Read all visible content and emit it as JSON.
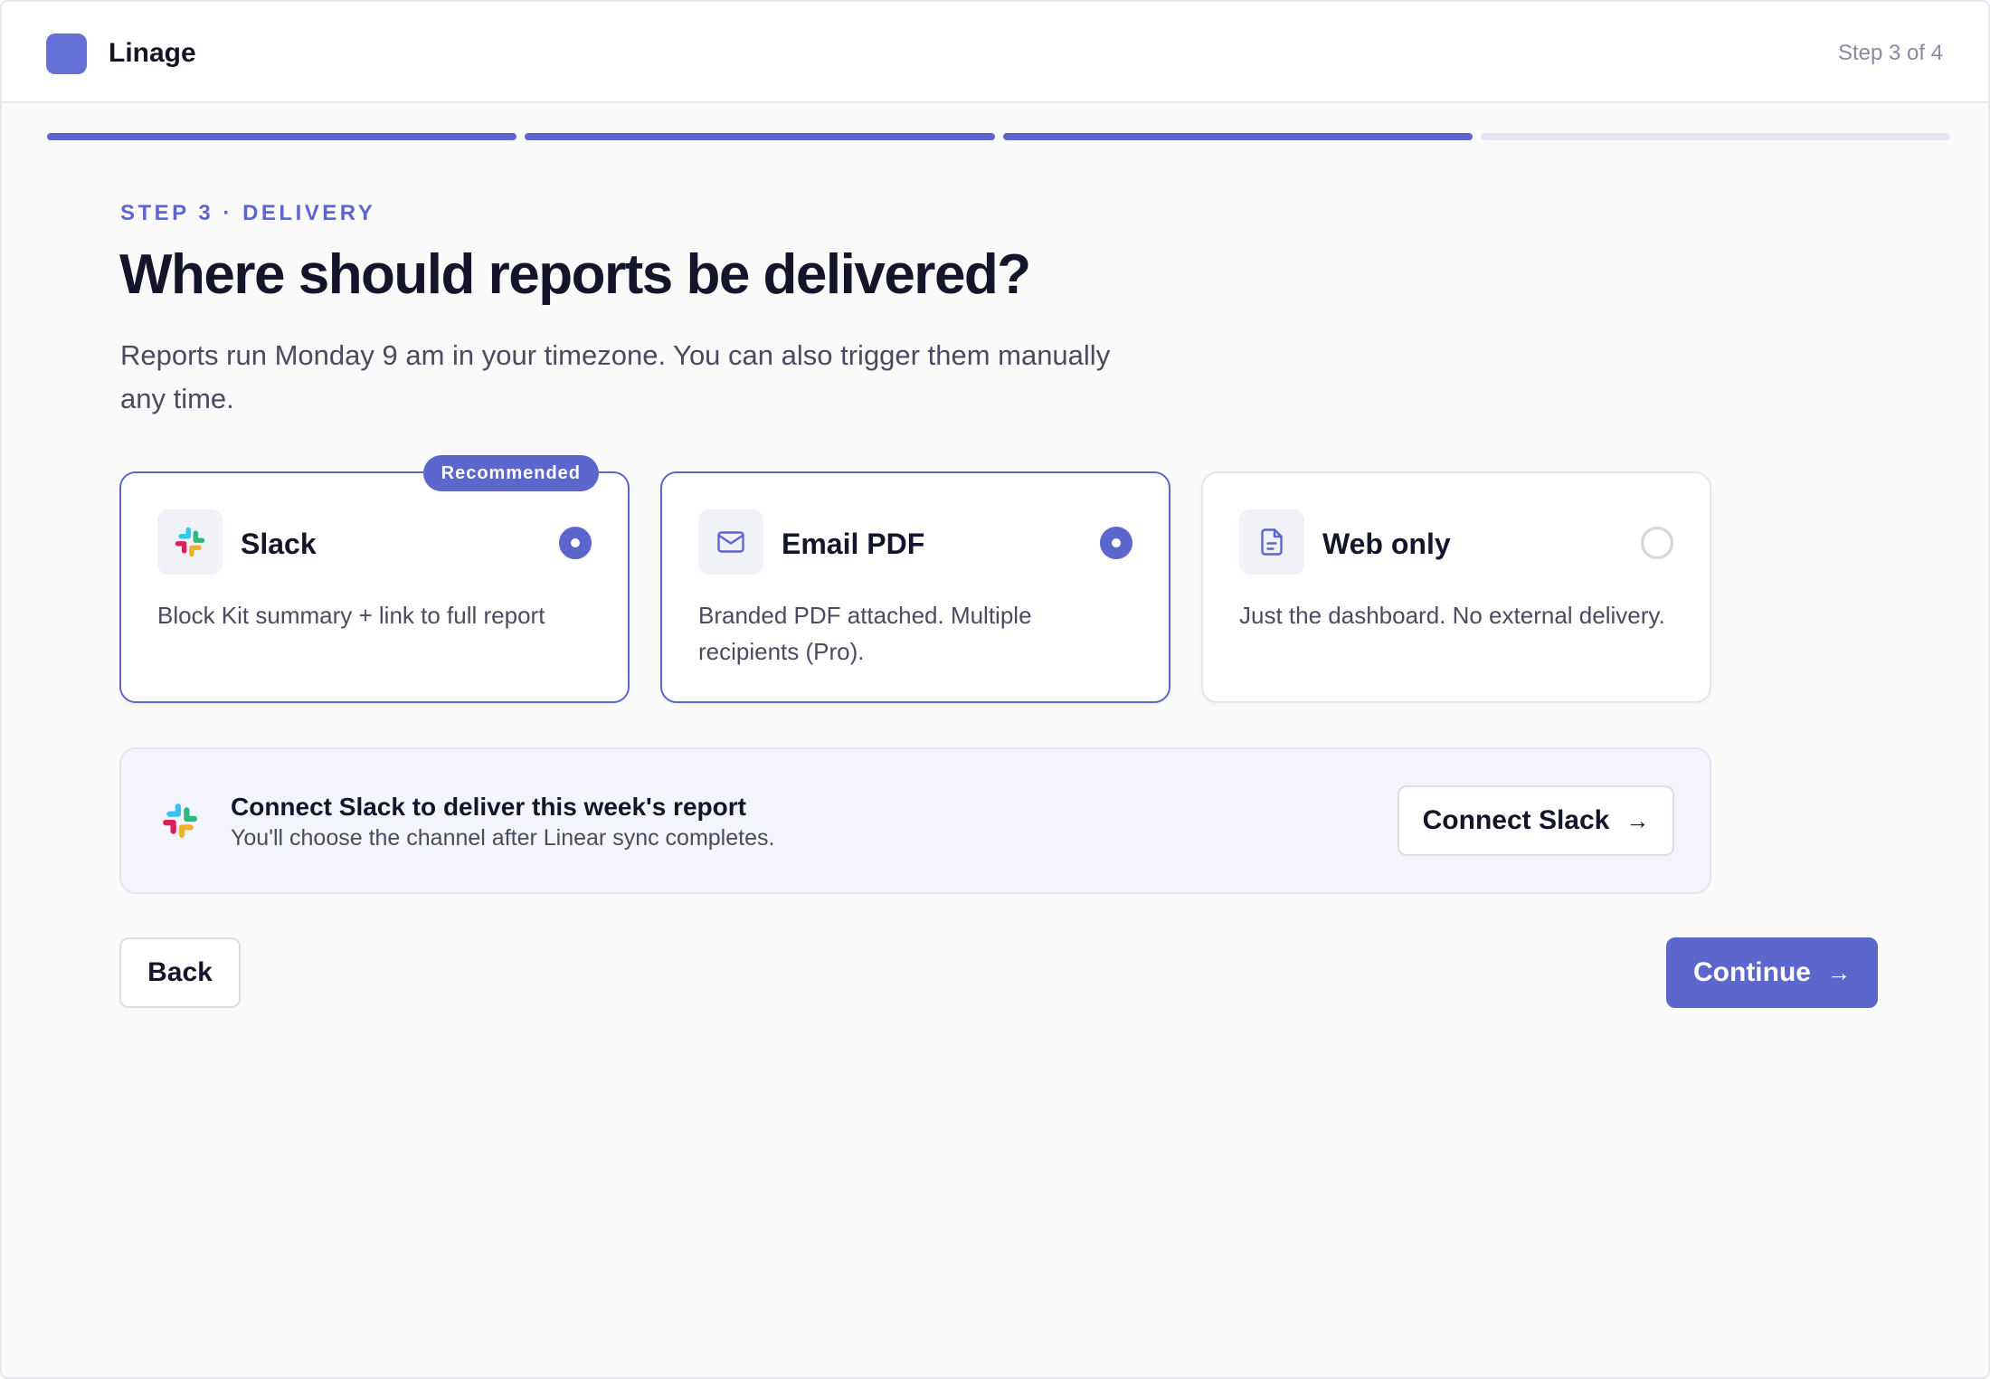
{
  "header": {
    "brand": "Linage",
    "step_count": "Step 3 of 4"
  },
  "progress": {
    "completed_steps": 3,
    "total_steps": 4
  },
  "eyebrow": "STEP 3 · DELIVERY",
  "title": "Where should reports be delivered?",
  "subtitle": "Reports run Monday 9 am in your timezone. You can also trigger them manually any time.",
  "options": [
    {
      "name": "Slack",
      "description": "Block Kit summary + link to full report",
      "badge": "Recommended",
      "icon": "slack-icon",
      "selected": true
    },
    {
      "name": "Email PDF",
      "description": "Branded PDF attached. Multiple recipients (Pro).",
      "icon": "mail-icon",
      "selected": true
    },
    {
      "name": "Web only",
      "description": "Just the dashboard. No external delivery.",
      "icon": "document-icon",
      "selected": false
    }
  ],
  "notice": {
    "title": "Connect Slack to deliver this week's report",
    "body": "You'll choose the channel after Linear sync completes.",
    "button_label": "Connect Slack",
    "icon": "slack-icon"
  },
  "footer": {
    "back_label": "Back",
    "continue_label": "Continue"
  },
  "colors": {
    "accent": "#5c66cc",
    "logo": "#6570d8",
    "progress_empty": "#e6e6f2",
    "text": "#14142b",
    "muted": "#4a4a60"
  }
}
